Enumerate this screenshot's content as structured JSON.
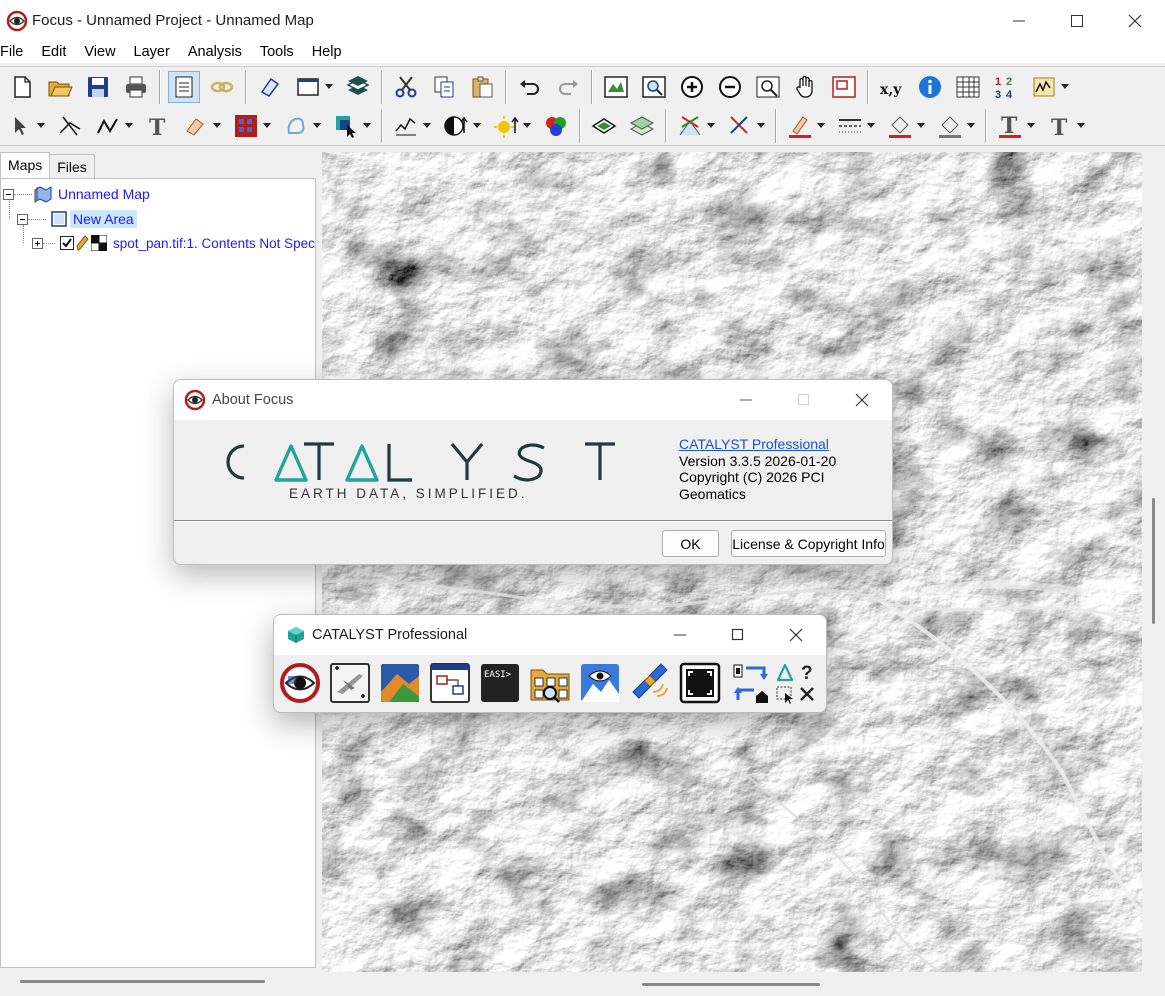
{
  "window": {
    "title": "Focus - Unnamed Project - Unnamed Map"
  },
  "menu": [
    "File",
    "Edit",
    "View",
    "Layer",
    "Analysis",
    "Tools",
    "Help"
  ],
  "left_pane": {
    "tabs": [
      "Maps",
      "Files"
    ],
    "tree": {
      "map": "Unnamed Map",
      "area": "New Area",
      "layer": "spot_pan.tif:1. Contents Not Spec"
    }
  },
  "about_dialog": {
    "title": "About Focus",
    "logo_text": "CATALYST",
    "tagline": "EARTH DATA, SIMPLIFIED.",
    "product_link": "CATALYST Professional",
    "version": "Version 3.3.5 2026-01-20",
    "copyright": "Copyright (C) 2026 PCI Geomatics",
    "ok_label": "OK",
    "license_label": "License & Copyright Info"
  },
  "launcher": {
    "title": "CATALYST Professional"
  },
  "colors": {
    "brand_teal": "#1fa59a",
    "link_blue": "#1a1aff",
    "selection": "#cce8ff"
  }
}
